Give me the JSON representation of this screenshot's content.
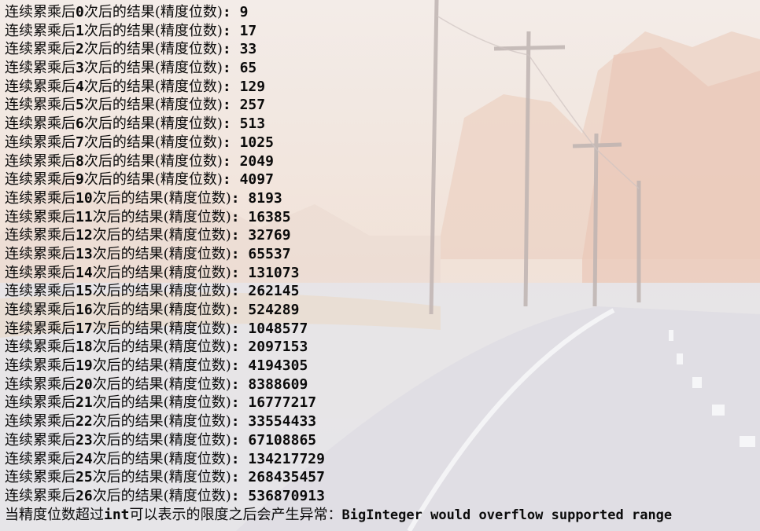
{
  "console": {
    "prefix": "连续累乘后",
    "suffix": "次后的结果(精度位数)",
    "separator": ": ",
    "lines": [
      {
        "n": "0",
        "value": "9"
      },
      {
        "n": "1",
        "value": "17"
      },
      {
        "n": "2",
        "value": "33"
      },
      {
        "n": "3",
        "value": "65"
      },
      {
        "n": "4",
        "value": "129"
      },
      {
        "n": "5",
        "value": "257"
      },
      {
        "n": "6",
        "value": "513"
      },
      {
        "n": "7",
        "value": "1025"
      },
      {
        "n": "8",
        "value": "2049"
      },
      {
        "n": "9",
        "value": "4097"
      },
      {
        "n": "10",
        "value": "8193"
      },
      {
        "n": "11",
        "value": "16385"
      },
      {
        "n": "12",
        "value": "32769"
      },
      {
        "n": "13",
        "value": "65537"
      },
      {
        "n": "14",
        "value": "131073"
      },
      {
        "n": "15",
        "value": "262145"
      },
      {
        "n": "16",
        "value": "524289"
      },
      {
        "n": "17",
        "value": "1048577"
      },
      {
        "n": "18",
        "value": "2097153"
      },
      {
        "n": "19",
        "value": "4194305"
      },
      {
        "n": "20",
        "value": "8388609"
      },
      {
        "n": "21",
        "value": "16777217"
      },
      {
        "n": "22",
        "value": "33554433"
      },
      {
        "n": "23",
        "value": "67108865"
      },
      {
        "n": "24",
        "value": "134217729"
      },
      {
        "n": "25",
        "value": "268435457"
      },
      {
        "n": "26",
        "value": "536870913"
      }
    ],
    "final": {
      "part1": "当精度位数超过",
      "keyword": "int",
      "part2": "可以表示的限度之后会产生异常：",
      "message": "BigInteger would overflow supported range"
    }
  }
}
